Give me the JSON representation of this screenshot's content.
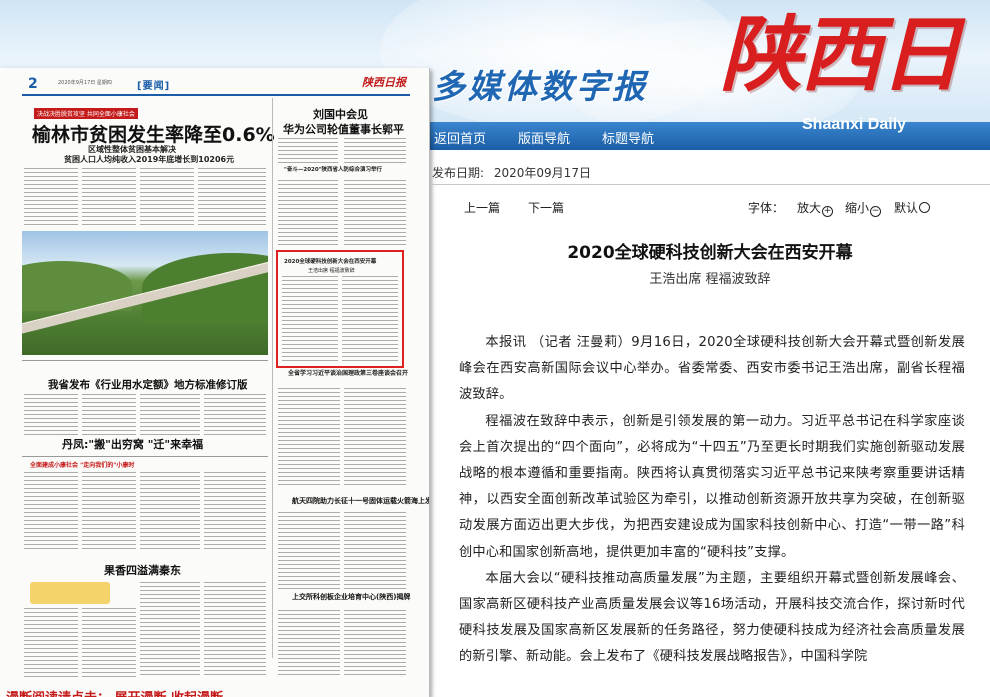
{
  "header": {
    "site_title": "多媒体数字报",
    "logo_cn": "陕西日报",
    "logo_en": "Shaanxi Daily"
  },
  "nav": {
    "items": [
      "返回首页",
      "版面导航",
      "标题导航"
    ]
  },
  "newspaper_page": {
    "page_number": "2",
    "header_small": "2020年9月17日  星期四",
    "section": "[要闻]",
    "masthead": "陕西日报",
    "top_tag": "决战决胜脱贫攻坚  共同全面小康社会",
    "lead_headline": "榆林市贫困发生率降至0.6%",
    "lead_sub1": "区域性整体贫困基本解决",
    "lead_sub2": "贫困人口人均纯收入2019年底增长到10206元",
    "right_headline1": "刘国中会见",
    "right_headline2": "华为公司轮值董事长郭平",
    "right_small": "\"奋斗—2020\"陕西省人防综合演习举行",
    "highlight_title": "2020全球硬科技创新大会在西安开幕",
    "highlight_sub": "王浩出席  程福波致辞",
    "story2_head": "全省学习习近平谈治国理政第三卷座谈会召开",
    "story3_head": "我省发布《行业用水定额》地方标准修订版",
    "story4_head": "丹凤:\"搬\"出穷窝  \"迁\"来幸福",
    "story5_tag": "全面建成小康社会  \"走向我们的\"小康时",
    "story6_head": "航天四院助力长征十一号固体运载火箭海上发射成功",
    "story7_head": "果香四溢满秦东",
    "story8_head": "上交所科创板企业培育中心(陕西)揭牌",
    "bottom_scroll": "漫断阅读请点击：  展开漫断  收起漫断"
  },
  "article": {
    "date_label": "发布日期:",
    "date_value": "2020年09月17日",
    "prev": "上一篇",
    "next": "下一篇",
    "font_label": "字体：",
    "zoom_in": "放大",
    "zoom_out": "缩小",
    "reset": "默认",
    "title": "2020全球硬科技创新大会在西安开幕",
    "subtitle": "王浩出席 程福波致辞",
    "paragraphs": [
      "本报讯 （记者 汪曼莉）9月16日，2020全球硬科技创新大会开幕式暨创新发展峰会在西安高新国际会议中心举办。省委常委、西安市委书记王浩出席，副省长程福波致辞。",
      "程福波在致辞中表示，创新是引领发展的第一动力。习近平总书记在科学家座谈会上首次提出的“四个面向”，必将成为“十四五”乃至更长时期我们实施创新驱动发展战略的根本遵循和重要指南。陕西将认真贯彻落实习近平总书记来陕考察重要讲话精神，以西安全面创新改革试验区为牵引，以推动创新资源开放共享为突破，在创新驱动发展方面迈出更大步伐，为把西安建设成为国家科技创新中心、打造“一带一路”科创中心和国家创新高地，提供更加丰富的“硬科技”支撑。",
      "本届大会以“硬科技推动高质量发展”为主题，主要组织开幕式暨创新发展峰会、国家高新区硬科技产业高质量发展会议等16场活动，开展科技交流合作，探讨新时代硬科技发展及国家高新区发展新的任务路径，努力使硬科技成为经济社会高质量发展的新引擎、新动能。会上发布了《硬科技发展战略报告》，中国科学院"
    ]
  },
  "colors": {
    "brand_red": "#d81e1e",
    "nav_blue": "#1b5ea6",
    "title_blue": "#1f66b3"
  }
}
